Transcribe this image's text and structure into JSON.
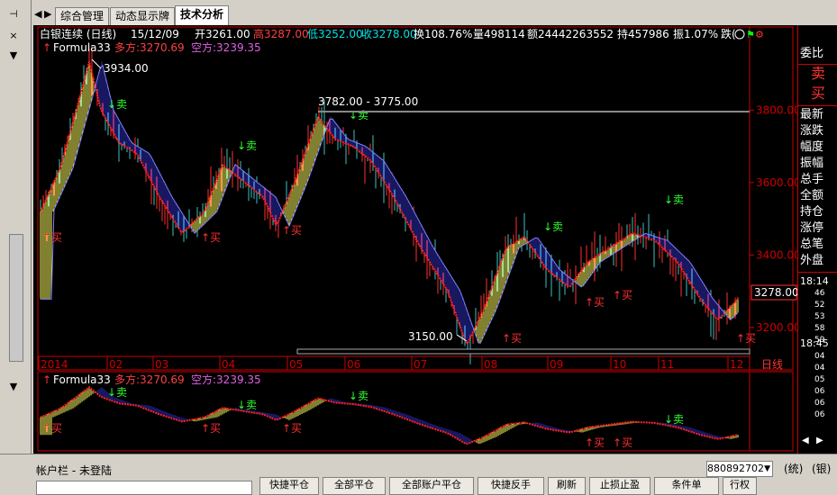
{
  "window_controls": {
    "pin_label": "中",
    "close_label": "×"
  },
  "tabs": [
    {
      "label": "综合管理"
    },
    {
      "label": "动态显示牌"
    },
    {
      "label": "技术分析"
    }
  ],
  "chart_header": {
    "symbol": "白银连续 (日线)",
    "date": "15/12/09",
    "open": "开3261.00",
    "high": "高3287.00",
    "low": "低3252.00",
    "close": "收3278.00",
    "turnover": "换108.76%",
    "volume": "量498114",
    "amount": "额24442263552",
    "position": "持457986",
    "amplitude": "振1.07%",
    "fall": "跌(",
    "formula_name": "Formula33",
    "long_label": "多方:3270.69",
    "short_label": "空方:3239.35"
  },
  "annotations": {
    "peak_high": "3934.00",
    "range_label": "3782.00 - 3775.00",
    "trough_low": "3150.00",
    "buy": "买",
    "sell": "卖",
    "current_price": "3278.00"
  },
  "y_axis_ticks": [
    "3800.00",
    "3600.00",
    "3400.00",
    "3200.00"
  ],
  "x_axis_ticks": [
    "2014",
    "02",
    "03",
    "04",
    "05",
    "06",
    "07",
    "08",
    "09",
    "10",
    "11",
    "12"
  ],
  "x_axis_period": "日线",
  "right_panel": {
    "top_label": "委比",
    "sell_label": "卖",
    "buy_label": "买",
    "fields": [
      "最新",
      "涨跌",
      "幅度",
      "振幅",
      "总手",
      "全额",
      "持仓",
      "涨停",
      "总笔",
      "外盘"
    ],
    "time_big": "18:14",
    "time_minutes": [
      "46",
      "52",
      "53",
      "58",
      "59"
    ],
    "time_big2": "18:45",
    "time_minutes2": [
      "04",
      "04",
      "05",
      "06",
      "06",
      "06"
    ]
  },
  "bottom": {
    "account_bar": "帐户栏  -  未登陆",
    "account_select": "880892702",
    "unlock_label": "(统)",
    "bank_label": "(银)",
    "buttons": [
      "快捷平仓",
      "全部平仓",
      "全部账户平仓",
      "快捷反手",
      "刷新",
      "止损止盈",
      "条件单",
      "行权"
    ]
  },
  "chart_data": {
    "type": "candlestick",
    "x_labels": [
      "2014",
      "02",
      "03",
      "04",
      "05",
      "06",
      "07",
      "08",
      "09",
      "10",
      "11",
      "12"
    ],
    "ylim": [
      3120,
      3960
    ],
    "series": [
      {
        "name": "多方",
        "last": 3270.69
      },
      {
        "name": "空方",
        "last": 3239.35
      }
    ],
    "key_points": [
      {
        "label": "3934.00",
        "value": 3934
      },
      {
        "label": "3782.00",
        "value": 3782
      },
      {
        "label": "3775.00",
        "value": 3775
      },
      {
        "label": "3150.00",
        "value": 3150
      },
      {
        "label": "3278.00",
        "value": 3278
      }
    ]
  }
}
